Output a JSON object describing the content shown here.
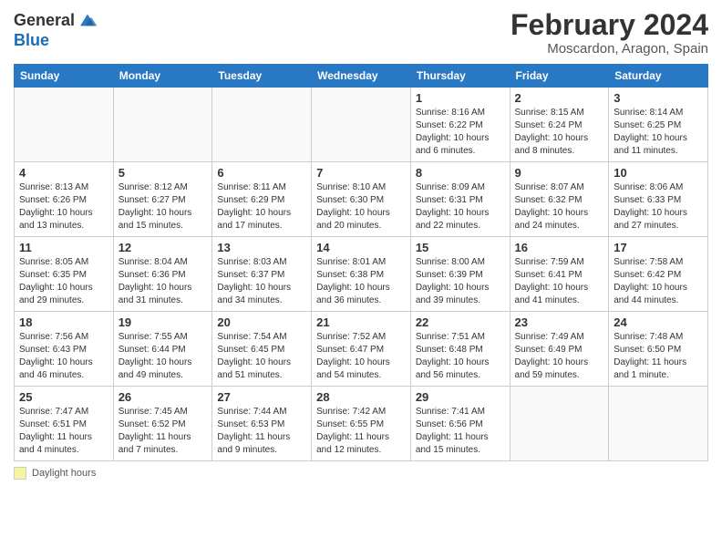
{
  "header": {
    "logo_general": "General",
    "logo_blue": "Blue",
    "month_year": "February 2024",
    "location": "Moscardon, Aragon, Spain"
  },
  "days_of_week": [
    "Sunday",
    "Monday",
    "Tuesday",
    "Wednesday",
    "Thursday",
    "Friday",
    "Saturday"
  ],
  "weeks": [
    [
      {
        "day": "",
        "info": ""
      },
      {
        "day": "",
        "info": ""
      },
      {
        "day": "",
        "info": ""
      },
      {
        "day": "",
        "info": ""
      },
      {
        "day": "1",
        "info": "Sunrise: 8:16 AM\nSunset: 6:22 PM\nDaylight: 10 hours and 6 minutes."
      },
      {
        "day": "2",
        "info": "Sunrise: 8:15 AM\nSunset: 6:24 PM\nDaylight: 10 hours and 8 minutes."
      },
      {
        "day": "3",
        "info": "Sunrise: 8:14 AM\nSunset: 6:25 PM\nDaylight: 10 hours and 11 minutes."
      }
    ],
    [
      {
        "day": "4",
        "info": "Sunrise: 8:13 AM\nSunset: 6:26 PM\nDaylight: 10 hours and 13 minutes."
      },
      {
        "day": "5",
        "info": "Sunrise: 8:12 AM\nSunset: 6:27 PM\nDaylight: 10 hours and 15 minutes."
      },
      {
        "day": "6",
        "info": "Sunrise: 8:11 AM\nSunset: 6:29 PM\nDaylight: 10 hours and 17 minutes."
      },
      {
        "day": "7",
        "info": "Sunrise: 8:10 AM\nSunset: 6:30 PM\nDaylight: 10 hours and 20 minutes."
      },
      {
        "day": "8",
        "info": "Sunrise: 8:09 AM\nSunset: 6:31 PM\nDaylight: 10 hours and 22 minutes."
      },
      {
        "day": "9",
        "info": "Sunrise: 8:07 AM\nSunset: 6:32 PM\nDaylight: 10 hours and 24 minutes."
      },
      {
        "day": "10",
        "info": "Sunrise: 8:06 AM\nSunset: 6:33 PM\nDaylight: 10 hours and 27 minutes."
      }
    ],
    [
      {
        "day": "11",
        "info": "Sunrise: 8:05 AM\nSunset: 6:35 PM\nDaylight: 10 hours and 29 minutes."
      },
      {
        "day": "12",
        "info": "Sunrise: 8:04 AM\nSunset: 6:36 PM\nDaylight: 10 hours and 31 minutes."
      },
      {
        "day": "13",
        "info": "Sunrise: 8:03 AM\nSunset: 6:37 PM\nDaylight: 10 hours and 34 minutes."
      },
      {
        "day": "14",
        "info": "Sunrise: 8:01 AM\nSunset: 6:38 PM\nDaylight: 10 hours and 36 minutes."
      },
      {
        "day": "15",
        "info": "Sunrise: 8:00 AM\nSunset: 6:39 PM\nDaylight: 10 hours and 39 minutes."
      },
      {
        "day": "16",
        "info": "Sunrise: 7:59 AM\nSunset: 6:41 PM\nDaylight: 10 hours and 41 minutes."
      },
      {
        "day": "17",
        "info": "Sunrise: 7:58 AM\nSunset: 6:42 PM\nDaylight: 10 hours and 44 minutes."
      }
    ],
    [
      {
        "day": "18",
        "info": "Sunrise: 7:56 AM\nSunset: 6:43 PM\nDaylight: 10 hours and 46 minutes."
      },
      {
        "day": "19",
        "info": "Sunrise: 7:55 AM\nSunset: 6:44 PM\nDaylight: 10 hours and 49 minutes."
      },
      {
        "day": "20",
        "info": "Sunrise: 7:54 AM\nSunset: 6:45 PM\nDaylight: 10 hours and 51 minutes."
      },
      {
        "day": "21",
        "info": "Sunrise: 7:52 AM\nSunset: 6:47 PM\nDaylight: 10 hours and 54 minutes."
      },
      {
        "day": "22",
        "info": "Sunrise: 7:51 AM\nSunset: 6:48 PM\nDaylight: 10 hours and 56 minutes."
      },
      {
        "day": "23",
        "info": "Sunrise: 7:49 AM\nSunset: 6:49 PM\nDaylight: 10 hours and 59 minutes."
      },
      {
        "day": "24",
        "info": "Sunrise: 7:48 AM\nSunset: 6:50 PM\nDaylight: 11 hours and 1 minute."
      }
    ],
    [
      {
        "day": "25",
        "info": "Sunrise: 7:47 AM\nSunset: 6:51 PM\nDaylight: 11 hours and 4 minutes."
      },
      {
        "day": "26",
        "info": "Sunrise: 7:45 AM\nSunset: 6:52 PM\nDaylight: 11 hours and 7 minutes."
      },
      {
        "day": "27",
        "info": "Sunrise: 7:44 AM\nSunset: 6:53 PM\nDaylight: 11 hours and 9 minutes."
      },
      {
        "day": "28",
        "info": "Sunrise: 7:42 AM\nSunset: 6:55 PM\nDaylight: 11 hours and 12 minutes."
      },
      {
        "day": "29",
        "info": "Sunrise: 7:41 AM\nSunset: 6:56 PM\nDaylight: 11 hours and 15 minutes."
      },
      {
        "day": "",
        "info": ""
      },
      {
        "day": "",
        "info": ""
      }
    ]
  ],
  "footer": {
    "daylight_label": "Daylight hours"
  }
}
